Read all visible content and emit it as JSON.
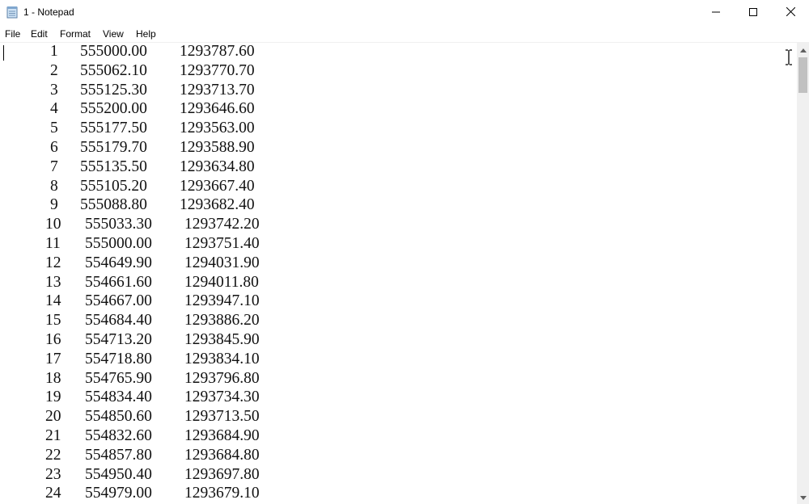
{
  "window": {
    "title": "1 - Notepad",
    "app_icon": "notepad-icon"
  },
  "menu": [
    "File",
    "Edit",
    "Format",
    "View",
    "Help"
  ],
  "rows": [
    [
      "1",
      "555000.00",
      "1293787.60"
    ],
    [
      "2",
      "555062.10",
      "1293770.70"
    ],
    [
      "3",
      "555125.30",
      "1293713.70"
    ],
    [
      "4",
      "555200.00",
      "1293646.60"
    ],
    [
      "5",
      "555177.50",
      "1293563.00"
    ],
    [
      "6",
      "555179.70",
      "1293588.90"
    ],
    [
      "7",
      "555135.50",
      "1293634.80"
    ],
    [
      "8",
      "555105.20",
      "1293667.40"
    ],
    [
      "9",
      "555088.80",
      "1293682.40"
    ],
    [
      "10",
      "555033.30",
      "1293742.20"
    ],
    [
      "11",
      "555000.00",
      "1293751.40"
    ],
    [
      "12",
      "554649.90",
      "1294031.90"
    ],
    [
      "13",
      "554661.60",
      "1294011.80"
    ],
    [
      "14",
      "554667.00",
      "1293947.10"
    ],
    [
      "15",
      "554684.40",
      "1293886.20"
    ],
    [
      "16",
      "554713.20",
      "1293845.90"
    ],
    [
      "17",
      "554718.80",
      "1293834.10"
    ],
    [
      "18",
      "554765.90",
      "1293796.80"
    ],
    [
      "19",
      "554834.40",
      "1293734.30"
    ],
    [
      "20",
      "554850.60",
      "1293713.50"
    ],
    [
      "21",
      "554832.60",
      "1293684.90"
    ],
    [
      "22",
      "554857.80",
      "1293684.80"
    ],
    [
      "23",
      "554950.40",
      "1293697.80"
    ],
    [
      "24",
      "554979.00",
      "1293679.10"
    ]
  ]
}
